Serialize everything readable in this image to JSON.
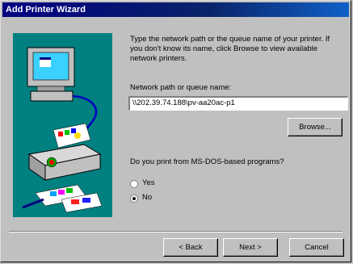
{
  "window": {
    "title": "Add Printer Wizard"
  },
  "intro_text": "Type the network path or the queue name of your printer. If you don't know its name, click Browse to view available network printers.",
  "path_label": "Network path or queue name:",
  "path_value": "\\\\202.39.74.188\\pv-aa20ac-p1",
  "browse_label": "Browse...",
  "msdos_question": "Do you print from MS-DOS-based programs?",
  "radio_yes": "Yes",
  "radio_no": "No",
  "selected_radio": "No",
  "buttons": {
    "back": "< Back",
    "next": "Next >",
    "cancel": "Cancel"
  },
  "colors": {
    "title_bar": "#000080",
    "art_background": "#008080",
    "window_bg": "#c0c0c0"
  }
}
